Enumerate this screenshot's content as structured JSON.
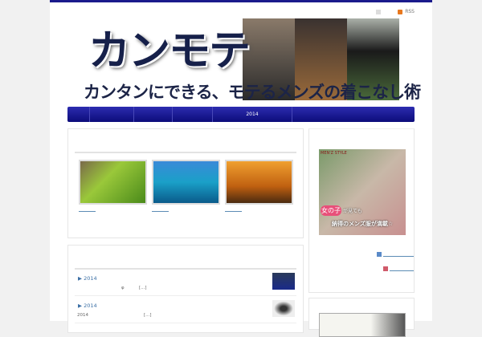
{
  "header": {
    "rss_label": "RSS",
    "logo": "カンモテ",
    "tagline": "カンタンにできる、モテるメンズの着こなし術"
  },
  "nav": {
    "items": [
      "",
      "",
      "",
      "",
      "2014",
      ""
    ]
  },
  "featured": {
    "thumbs": [
      {
        "alt": "grass"
      },
      {
        "alt": "surf"
      },
      {
        "alt": "sunset"
      }
    ]
  },
  "posts": [
    {
      "title": "▶ 2014",
      "excerpt_a": "",
      "mark": "φ",
      "more": "[...]"
    },
    {
      "title": "▶ 2014",
      "excerpt_a": "2014",
      "mark": "",
      "more": "[...]"
    }
  ],
  "sidebar": {
    "banner_brand": "MEN'Z STYLE",
    "banner_text1": "女の子",
    "banner_text2": "が見ても",
    "banner_text3": "納得のメンズ服が満載☆"
  }
}
